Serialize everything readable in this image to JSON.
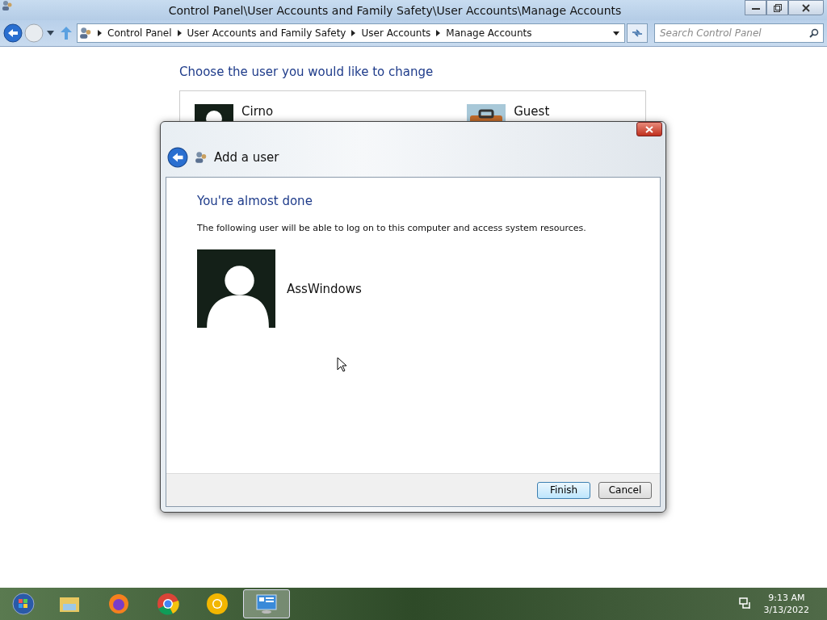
{
  "window": {
    "title": "Control Panel\\User Accounts and Family Safety\\User Accounts\\Manage Accounts"
  },
  "address_bar": {
    "crumbs": [
      "Control Panel",
      "User Accounts and Family Safety",
      "User Accounts",
      "Manage Accounts"
    ],
    "search": {
      "placeholder": "Search Control Panel"
    }
  },
  "content": {
    "heading": "Choose the user you would like to change",
    "accounts": [
      {
        "name": "Cirno",
        "kind": "person"
      },
      {
        "name": "Guest",
        "kind": "guest"
      }
    ]
  },
  "dialog": {
    "title": "Add a user",
    "heading": "You're almost done",
    "message": "The following user will be able to log on to this computer and access system resources.",
    "user": {
      "name": "AssWindows"
    },
    "buttons": [
      {
        "label": "Finish",
        "default": true
      },
      {
        "label": "Cancel",
        "default": false
      }
    ]
  },
  "taskbar": {
    "items": [
      {
        "kind": "explorer",
        "selected": false
      },
      {
        "kind": "firefox",
        "selected": false
      },
      {
        "kind": "chrome",
        "selected": false
      },
      {
        "kind": "canary",
        "selected": false
      },
      {
        "kind": "control-panel",
        "selected": true
      }
    ],
    "time": "9:13 AM",
    "date": "3/13/2022"
  }
}
